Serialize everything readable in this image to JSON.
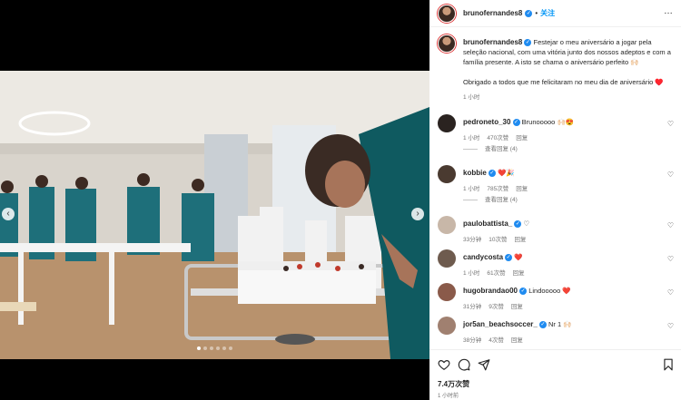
{
  "post": {
    "username": "brunofernandes8",
    "follow_label": "关注",
    "separator": "•",
    "more": "…",
    "likes": "7.4万次赞",
    "date": "1 小时前"
  },
  "caption": {
    "username": "brunofernandes8",
    "text": "Festejar o meu aniversário a jogar pela seleção nacional, com uma vitória junto dos nossos adeptos e com a família presente. A isto se chama o aniversário perfeito 🙌🏻",
    "text2": "Obrigado a todos que me felicitaram no meu dia de aniversário ♥️",
    "time": "1 小时"
  },
  "comments": [
    {
      "user": "pedroneto_30",
      "text": "Brunooooo 🙌🏻😍",
      "time": "1 小时",
      "likes": "470次赞",
      "reply": "回复",
      "view_replies": "查看回复 (4)"
    },
    {
      "user": "kobbie",
      "text": "❤️🎉",
      "time": "1 小时",
      "likes": "785次赞",
      "reply": "回复",
      "view_replies": "查看回复 (4)"
    },
    {
      "user": "paulobattista_",
      "text": "♡",
      "time": "33分钟",
      "likes": "10次赞",
      "reply": "回复"
    },
    {
      "user": "candycosta",
      "text": "❤️",
      "time": "1 小时",
      "likes": "61次赞",
      "reply": "回复"
    },
    {
      "user": "hugobrandao00",
      "text": "Lindooooo ❤️",
      "time": "31分钟",
      "likes": "9次赞",
      "reply": "回复"
    },
    {
      "user": "jor5an_beachsoccer_",
      "text": "Nr 1 🙌🏻",
      "time": "38分钟",
      "likes": "4次赞",
      "reply": "回复"
    }
  ],
  "icons": {
    "verified": "verified-badge-icon",
    "heart": "heart-icon",
    "comment": "comment-icon",
    "share": "share-icon",
    "save": "bookmark-icon",
    "prev": "chevron-left-icon",
    "next": "chevron-right-icon"
  },
  "carousel": {
    "count": 6,
    "active": 0,
    "prev": "‹",
    "next": "›"
  },
  "colors": {
    "accent": "#0095f6",
    "verified": "#1f8bf0",
    "heart": "#ed4956"
  }
}
